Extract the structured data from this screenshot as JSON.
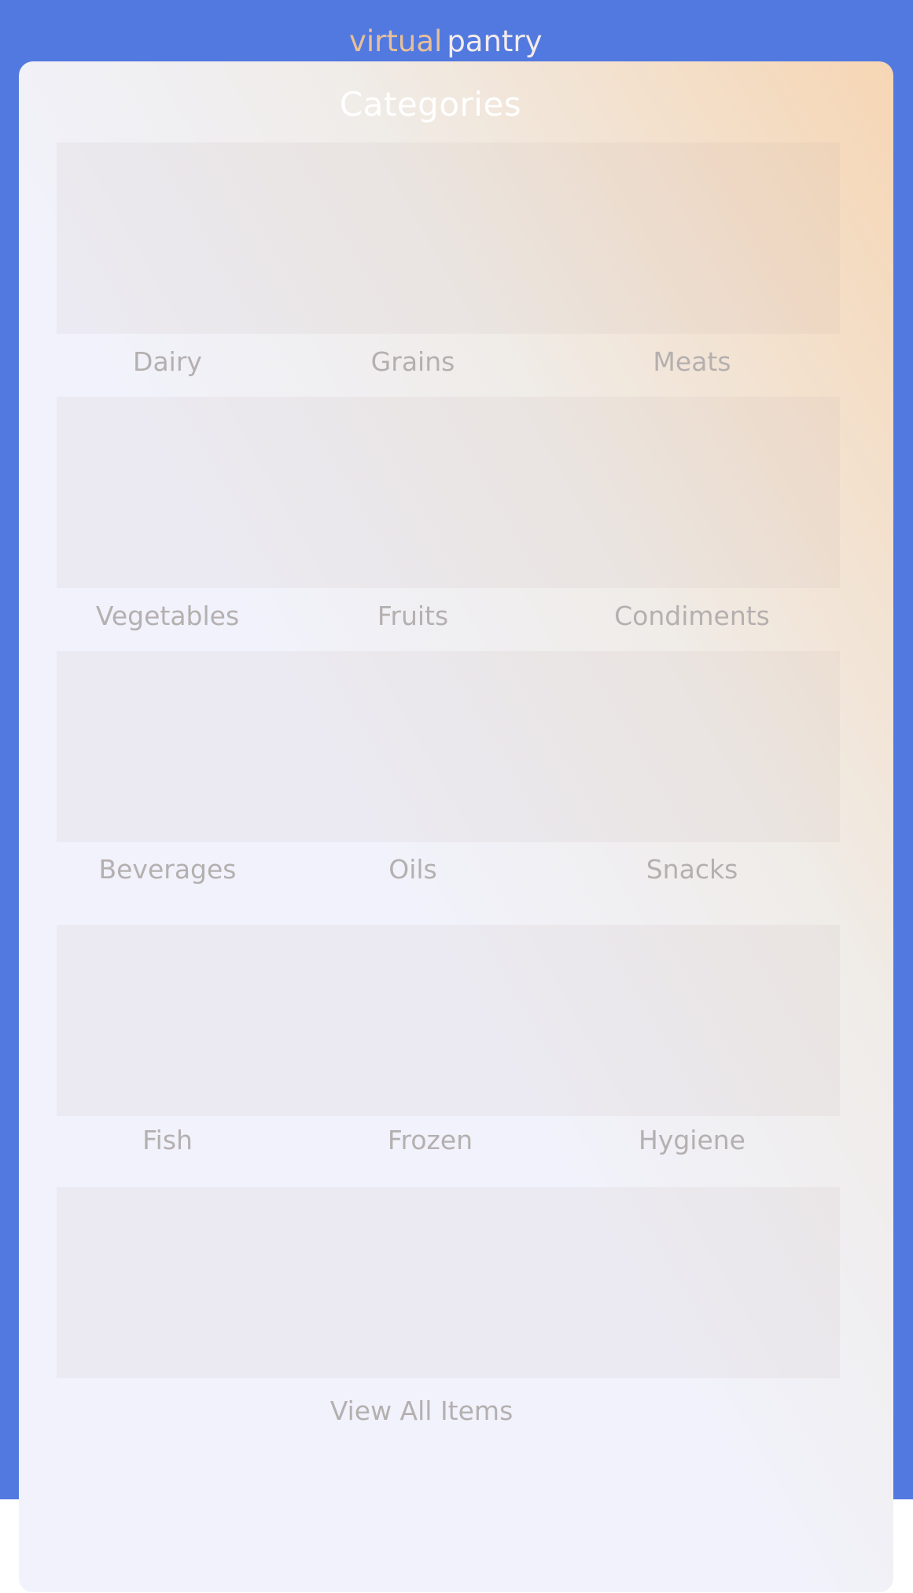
{
  "brand": {
    "part1": "virtual",
    "part2": "pantry"
  },
  "header": {
    "title": "Categories"
  },
  "categories": {
    "row1": [
      "Dairy",
      "Grains",
      "Meats"
    ],
    "row2": [
      "Vegetables",
      "Fruits",
      "Condiments"
    ],
    "row3": [
      "Beverages",
      "Oils",
      "Snacks"
    ],
    "row4": [
      "Fish",
      "Frozen",
      "Hygiene"
    ]
  },
  "view_all": {
    "label": "View All Items"
  },
  "colors": {
    "background_blue": "#5279df",
    "brand_accent": "#e7c09a",
    "card_gradient_start": "#f6d6b4",
    "card_gradient_end": "#f1f2fb",
    "label_gray": "#b5b0b0"
  }
}
